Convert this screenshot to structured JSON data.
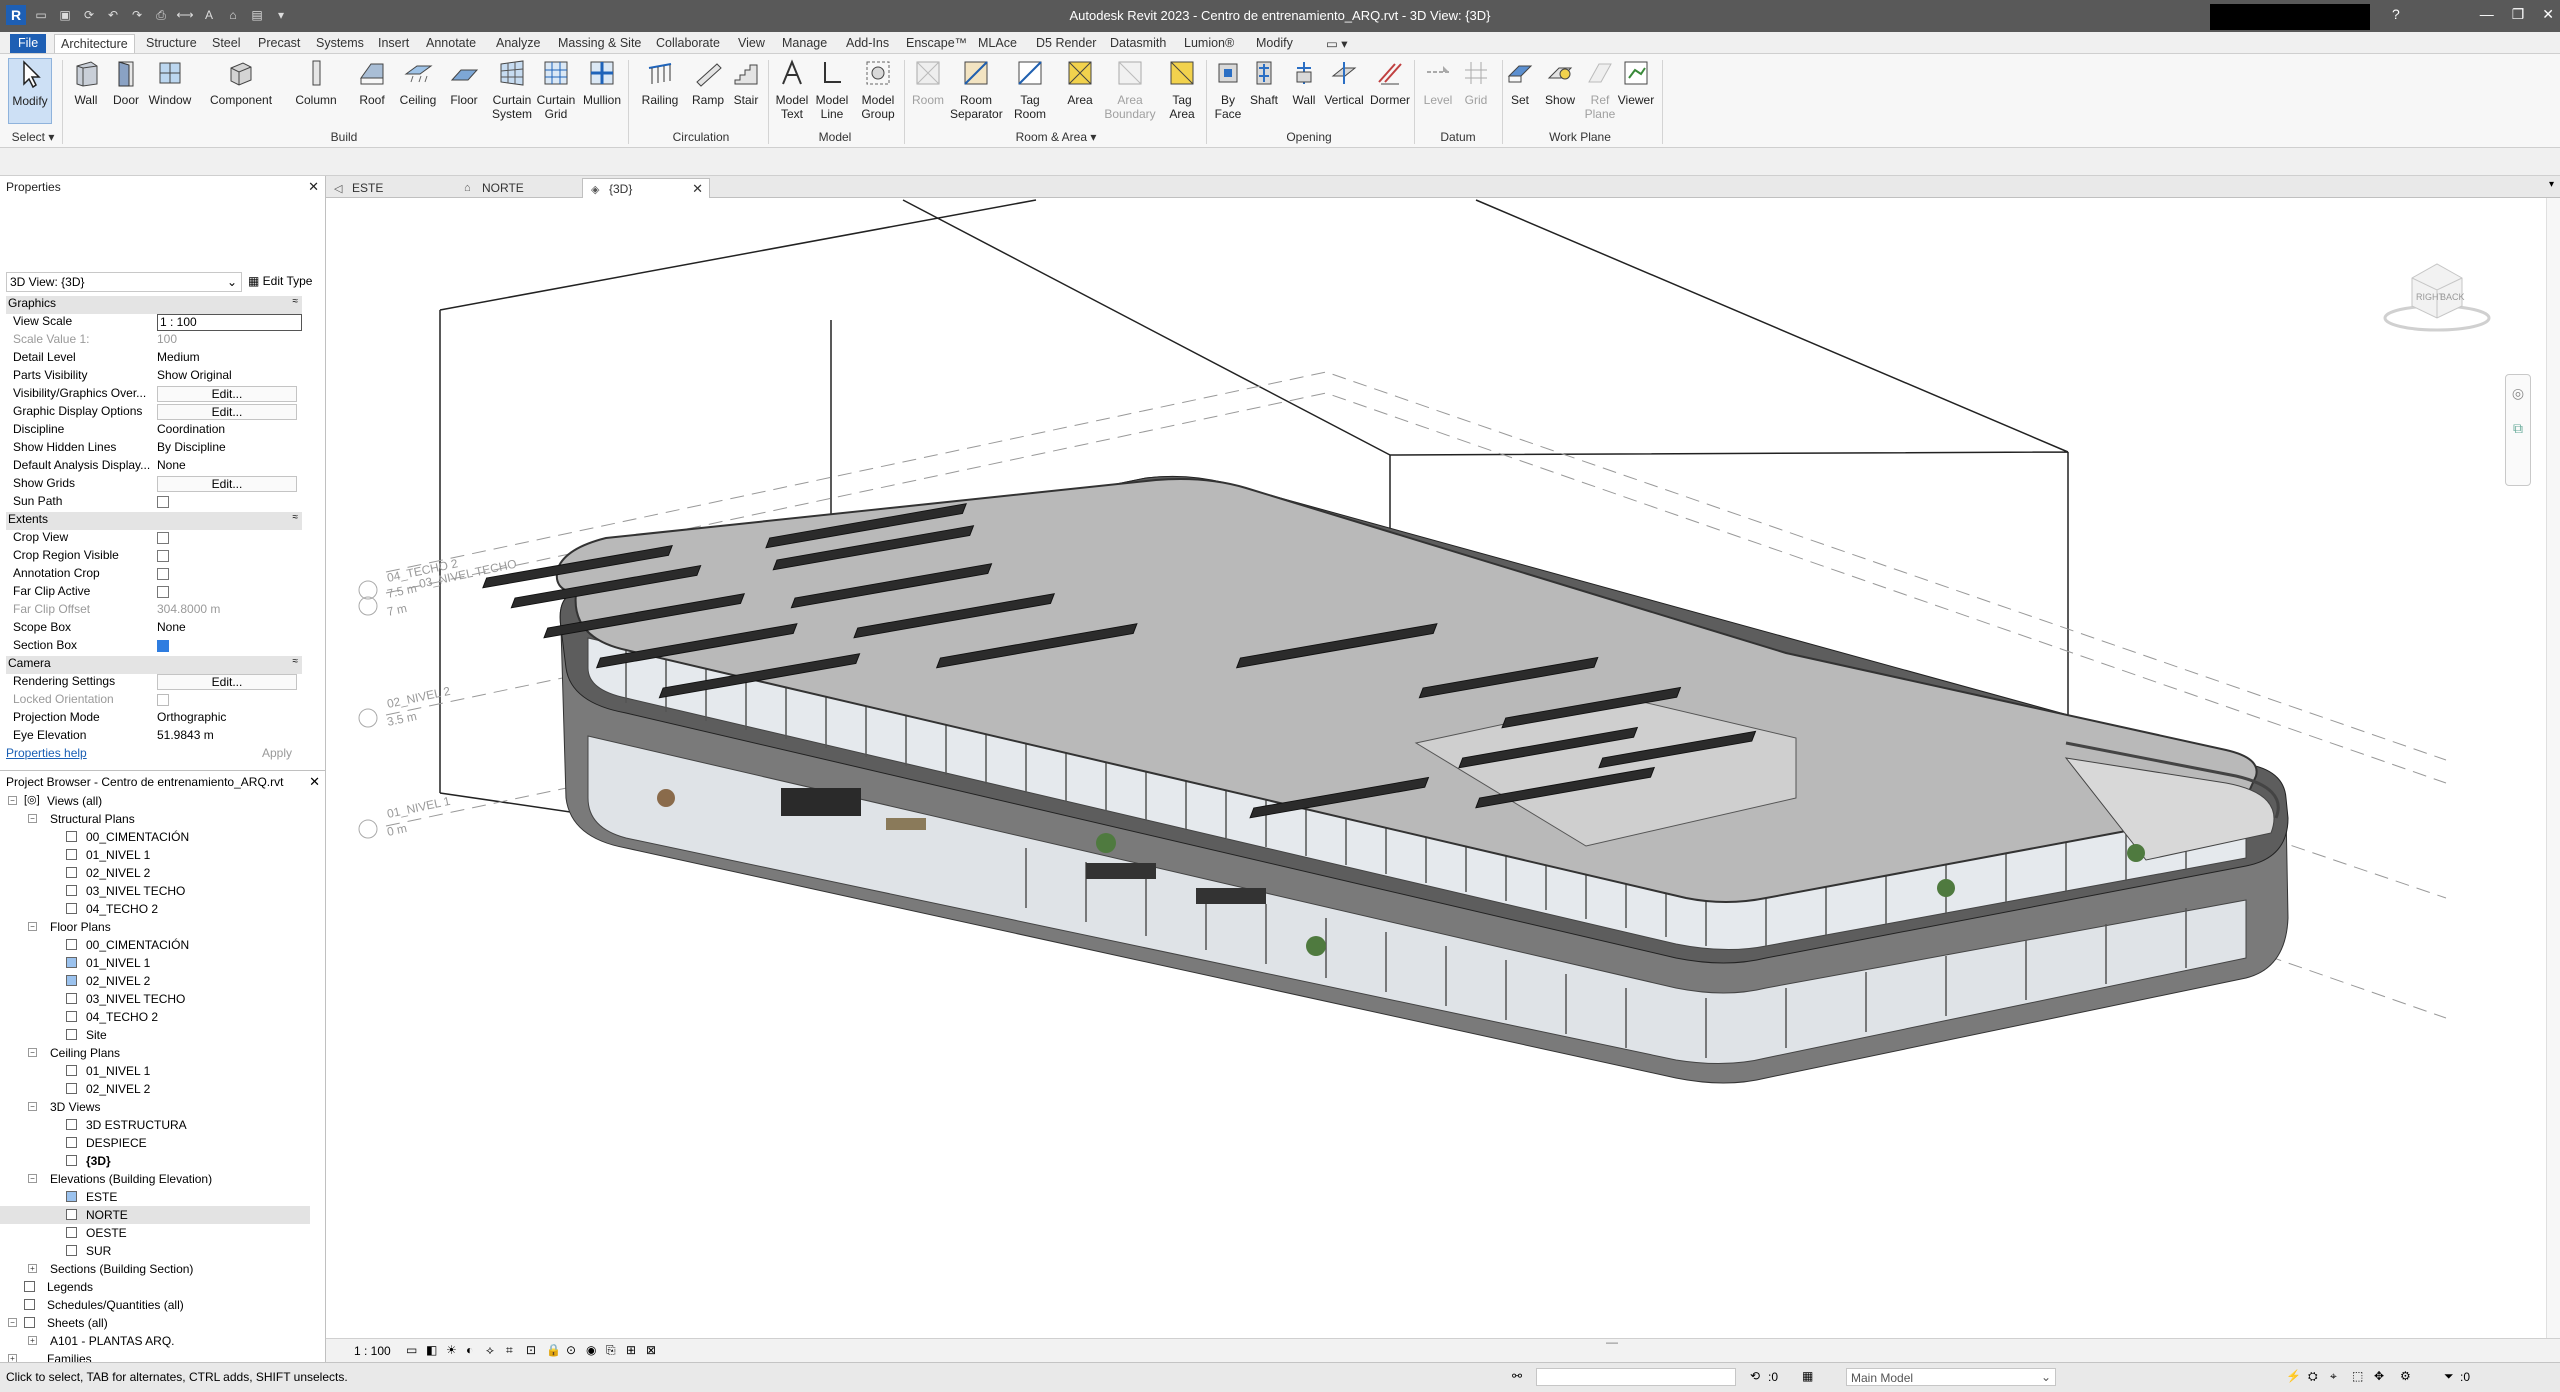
{
  "app_title": "Autodesk Revit 2023 - Centro de entrenamiento_ARQ.rvt - 3D View: {3D}",
  "ribbon_tabs": [
    "File",
    "Architecture",
    "Structure",
    "Steel",
    "Precast",
    "Systems",
    "Insert",
    "Annotate",
    "Analyze",
    "Massing & Site",
    "Collaborate",
    "View",
    "Manage",
    "Add-Ins",
    "Enscape™",
    "MLAce",
    "D5 Render",
    "Datasmith",
    "Lumion®",
    "Modify"
  ],
  "ribbon_tools": {
    "modify": "Modify",
    "wall": "Wall",
    "door": "Door",
    "window": "Window",
    "component": "Component",
    "column": "Column",
    "roof": "Roof",
    "ceiling": "Ceiling",
    "floor": "Floor",
    "curtain_system_1": "Curtain",
    "curtain_system_2": "System",
    "curtain_grid_1": "Curtain",
    "curtain_grid_2": "Grid",
    "mullion": "Mullion",
    "railing": "Railing",
    "ramp": "Ramp",
    "stair": "Stair",
    "model_text_1": "Model",
    "model_text_2": "Text",
    "model_line_1": "Model",
    "model_line_2": "Line",
    "model_group_1": "Model",
    "model_group_2": "Group",
    "room": "Room",
    "room_sep_1": "Room",
    "room_sep_2": "Separator",
    "tag_room_1": "Tag",
    "tag_room_2": "Room",
    "area": "Area",
    "area_boundary_1": "Area",
    "area_boundary_2": "Boundary",
    "tag_area_1": "Tag",
    "tag_area_2": "Area",
    "by_face_1": "By",
    "by_face_2": "Face",
    "shaft": "Shaft",
    "open_wall": "Wall",
    "vertical": "Vertical",
    "dormer": "Dormer",
    "level": "Level",
    "grid": "Grid",
    "set": "Set",
    "show": "Show",
    "ref_plane_1": "Ref",
    "ref_plane_2": "Plane",
    "viewer": "Viewer"
  },
  "ribbon_groups": {
    "select": "Select ▾",
    "build": "Build",
    "circulation": "Circulation",
    "model": "Model",
    "room_area": "Room & Area ▾",
    "opening": "Opening",
    "datum": "Datum",
    "work_plane": "Work Plane"
  },
  "properties": {
    "title": "Properties",
    "type": "3D View: {3D}",
    "edit_type": "Edit Type",
    "sections": {
      "graphics": "Graphics",
      "extents": "Extents",
      "camera": "Camera"
    },
    "graphics": [
      {
        "k": "View Scale",
        "v": "1 : 100"
      },
      {
        "k": "Scale Value   1:",
        "v": "100"
      },
      {
        "k": "Detail Level",
        "v": "Medium"
      },
      {
        "k": "Parts Visibility",
        "v": "Show Original"
      },
      {
        "k": "Visibility/Graphics Over...",
        "v": "Edit..."
      },
      {
        "k": "Graphic Display Options",
        "v": "Edit..."
      },
      {
        "k": "Discipline",
        "v": "Coordination"
      },
      {
        "k": "Show Hidden Lines",
        "v": "By Discipline"
      },
      {
        "k": "Default Analysis Display...",
        "v": "None"
      },
      {
        "k": "Show Grids",
        "v": "Edit..."
      },
      {
        "k": "Sun Path",
        "v": ""
      }
    ],
    "extents": [
      {
        "k": "Crop View",
        "v": ""
      },
      {
        "k": "Crop Region Visible",
        "v": ""
      },
      {
        "k": "Annotation Crop",
        "v": ""
      },
      {
        "k": "Far Clip Active",
        "v": ""
      },
      {
        "k": "Far Clip Offset",
        "v": "304.8000 m"
      },
      {
        "k": "Scope Box",
        "v": "None"
      },
      {
        "k": "Section Box",
        "v": ""
      }
    ],
    "camera": [
      {
        "k": "Rendering Settings",
        "v": "Edit..."
      },
      {
        "k": "Locked Orientation",
        "v": ""
      },
      {
        "k": "Projection Mode",
        "v": "Orthographic"
      },
      {
        "k": "Eye Elevation",
        "v": "51.9843 m"
      }
    ],
    "help": "Properties help",
    "apply": "Apply"
  },
  "browser": {
    "title": "Project Browser - Centro de entrenamiento_ARQ.rvt",
    "items": [
      "Views (all)",
      "Structural Plans",
      "00_CIMENTACIÓN",
      "01_NIVEL 1",
      "02_NIVEL 2",
      "03_NIVEL TECHO",
      "04_TECHO 2",
      "Floor Plans",
      "00_CIMENTACIÓN",
      "01_NIVEL 1",
      "02_NIVEL 2",
      "03_NIVEL TECHO",
      "04_TECHO 2",
      "Site",
      "Ceiling Plans",
      "01_NIVEL 1",
      "02_NIVEL 2",
      "3D Views",
      "3D ESTRUCTURA",
      "DESPIECE",
      "{3D}",
      "Elevations (Building Elevation)",
      "ESTE",
      "NORTE",
      "OESTE",
      "SUR",
      "Sections (Building Section)",
      "Legends",
      "Schedules/Quantities (all)",
      "Sheets (all)",
      "A101 - PLANTAS ARQ.",
      "Families"
    ]
  },
  "view_tabs": [
    "ESTE",
    "NORTE",
    "{3D}"
  ],
  "viewport": {
    "levels": [
      {
        "name": "04_TECHO 2",
        "elev": "7.5 m"
      },
      {
        "name": "03_NIVEL TECHO",
        "elev": "7 m"
      },
      {
        "name": "02_NIVEL 2",
        "elev": "3.5 m"
      },
      {
        "name": "01_NIVEL 1",
        "elev": "0 m"
      }
    ],
    "viewcube_right": "RIGHT",
    "viewcube_back": "BACK"
  },
  "view_scale": "1 : 100",
  "status": {
    "message": "Click to select, TAB for alternates, CTRL adds, SHIFT unselects.",
    "zero_a": ":0",
    "model": "Main Model",
    "zero_b": ":0"
  }
}
